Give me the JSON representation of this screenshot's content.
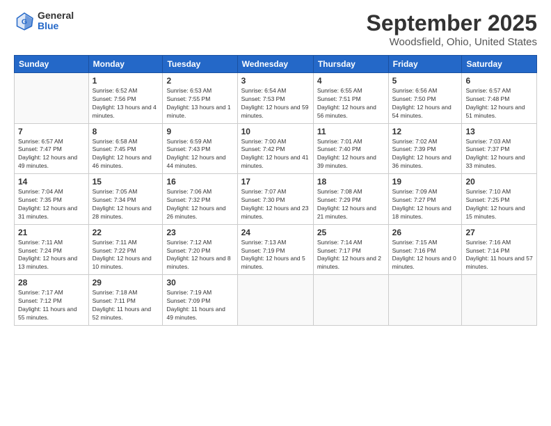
{
  "logo": {
    "line1": "General",
    "line2": "Blue"
  },
  "title": "September 2025",
  "subtitle": "Woodsfield, Ohio, United States",
  "days_of_week": [
    "Sunday",
    "Monday",
    "Tuesday",
    "Wednesday",
    "Thursday",
    "Friday",
    "Saturday"
  ],
  "weeks": [
    [
      {
        "day": "",
        "sunrise": "",
        "sunset": "",
        "daylight": ""
      },
      {
        "day": "1",
        "sunrise": "Sunrise: 6:52 AM",
        "sunset": "Sunset: 7:56 PM",
        "daylight": "Daylight: 13 hours and 4 minutes."
      },
      {
        "day": "2",
        "sunrise": "Sunrise: 6:53 AM",
        "sunset": "Sunset: 7:55 PM",
        "daylight": "Daylight: 13 hours and 1 minute."
      },
      {
        "day": "3",
        "sunrise": "Sunrise: 6:54 AM",
        "sunset": "Sunset: 7:53 PM",
        "daylight": "Daylight: 12 hours and 59 minutes."
      },
      {
        "day": "4",
        "sunrise": "Sunrise: 6:55 AM",
        "sunset": "Sunset: 7:51 PM",
        "daylight": "Daylight: 12 hours and 56 minutes."
      },
      {
        "day": "5",
        "sunrise": "Sunrise: 6:56 AM",
        "sunset": "Sunset: 7:50 PM",
        "daylight": "Daylight: 12 hours and 54 minutes."
      },
      {
        "day": "6",
        "sunrise": "Sunrise: 6:57 AM",
        "sunset": "Sunset: 7:48 PM",
        "daylight": "Daylight: 12 hours and 51 minutes."
      }
    ],
    [
      {
        "day": "7",
        "sunrise": "Sunrise: 6:57 AM",
        "sunset": "Sunset: 7:47 PM",
        "daylight": "Daylight: 12 hours and 49 minutes."
      },
      {
        "day": "8",
        "sunrise": "Sunrise: 6:58 AM",
        "sunset": "Sunset: 7:45 PM",
        "daylight": "Daylight: 12 hours and 46 minutes."
      },
      {
        "day": "9",
        "sunrise": "Sunrise: 6:59 AM",
        "sunset": "Sunset: 7:43 PM",
        "daylight": "Daylight: 12 hours and 44 minutes."
      },
      {
        "day": "10",
        "sunrise": "Sunrise: 7:00 AM",
        "sunset": "Sunset: 7:42 PM",
        "daylight": "Daylight: 12 hours and 41 minutes."
      },
      {
        "day": "11",
        "sunrise": "Sunrise: 7:01 AM",
        "sunset": "Sunset: 7:40 PM",
        "daylight": "Daylight: 12 hours and 39 minutes."
      },
      {
        "day": "12",
        "sunrise": "Sunrise: 7:02 AM",
        "sunset": "Sunset: 7:39 PM",
        "daylight": "Daylight: 12 hours and 36 minutes."
      },
      {
        "day": "13",
        "sunrise": "Sunrise: 7:03 AM",
        "sunset": "Sunset: 7:37 PM",
        "daylight": "Daylight: 12 hours and 33 minutes."
      }
    ],
    [
      {
        "day": "14",
        "sunrise": "Sunrise: 7:04 AM",
        "sunset": "Sunset: 7:35 PM",
        "daylight": "Daylight: 12 hours and 31 minutes."
      },
      {
        "day": "15",
        "sunrise": "Sunrise: 7:05 AM",
        "sunset": "Sunset: 7:34 PM",
        "daylight": "Daylight: 12 hours and 28 minutes."
      },
      {
        "day": "16",
        "sunrise": "Sunrise: 7:06 AM",
        "sunset": "Sunset: 7:32 PM",
        "daylight": "Daylight: 12 hours and 26 minutes."
      },
      {
        "day": "17",
        "sunrise": "Sunrise: 7:07 AM",
        "sunset": "Sunset: 7:30 PM",
        "daylight": "Daylight: 12 hours and 23 minutes."
      },
      {
        "day": "18",
        "sunrise": "Sunrise: 7:08 AM",
        "sunset": "Sunset: 7:29 PM",
        "daylight": "Daylight: 12 hours and 21 minutes."
      },
      {
        "day": "19",
        "sunrise": "Sunrise: 7:09 AM",
        "sunset": "Sunset: 7:27 PM",
        "daylight": "Daylight: 12 hours and 18 minutes."
      },
      {
        "day": "20",
        "sunrise": "Sunrise: 7:10 AM",
        "sunset": "Sunset: 7:25 PM",
        "daylight": "Daylight: 12 hours and 15 minutes."
      }
    ],
    [
      {
        "day": "21",
        "sunrise": "Sunrise: 7:11 AM",
        "sunset": "Sunset: 7:24 PM",
        "daylight": "Daylight: 12 hours and 13 minutes."
      },
      {
        "day": "22",
        "sunrise": "Sunrise: 7:11 AM",
        "sunset": "Sunset: 7:22 PM",
        "daylight": "Daylight: 12 hours and 10 minutes."
      },
      {
        "day": "23",
        "sunrise": "Sunrise: 7:12 AM",
        "sunset": "Sunset: 7:20 PM",
        "daylight": "Daylight: 12 hours and 8 minutes."
      },
      {
        "day": "24",
        "sunrise": "Sunrise: 7:13 AM",
        "sunset": "Sunset: 7:19 PM",
        "daylight": "Daylight: 12 hours and 5 minutes."
      },
      {
        "day": "25",
        "sunrise": "Sunrise: 7:14 AM",
        "sunset": "Sunset: 7:17 PM",
        "daylight": "Daylight: 12 hours and 2 minutes."
      },
      {
        "day": "26",
        "sunrise": "Sunrise: 7:15 AM",
        "sunset": "Sunset: 7:16 PM",
        "daylight": "Daylight: 12 hours and 0 minutes."
      },
      {
        "day": "27",
        "sunrise": "Sunrise: 7:16 AM",
        "sunset": "Sunset: 7:14 PM",
        "daylight": "Daylight: 11 hours and 57 minutes."
      }
    ],
    [
      {
        "day": "28",
        "sunrise": "Sunrise: 7:17 AM",
        "sunset": "Sunset: 7:12 PM",
        "daylight": "Daylight: 11 hours and 55 minutes."
      },
      {
        "day": "29",
        "sunrise": "Sunrise: 7:18 AM",
        "sunset": "Sunset: 7:11 PM",
        "daylight": "Daylight: 11 hours and 52 minutes."
      },
      {
        "day": "30",
        "sunrise": "Sunrise: 7:19 AM",
        "sunset": "Sunset: 7:09 PM",
        "daylight": "Daylight: 11 hours and 49 minutes."
      },
      {
        "day": "",
        "sunrise": "",
        "sunset": "",
        "daylight": ""
      },
      {
        "day": "",
        "sunrise": "",
        "sunset": "",
        "daylight": ""
      },
      {
        "day": "",
        "sunrise": "",
        "sunset": "",
        "daylight": ""
      },
      {
        "day": "",
        "sunrise": "",
        "sunset": "",
        "daylight": ""
      }
    ]
  ]
}
